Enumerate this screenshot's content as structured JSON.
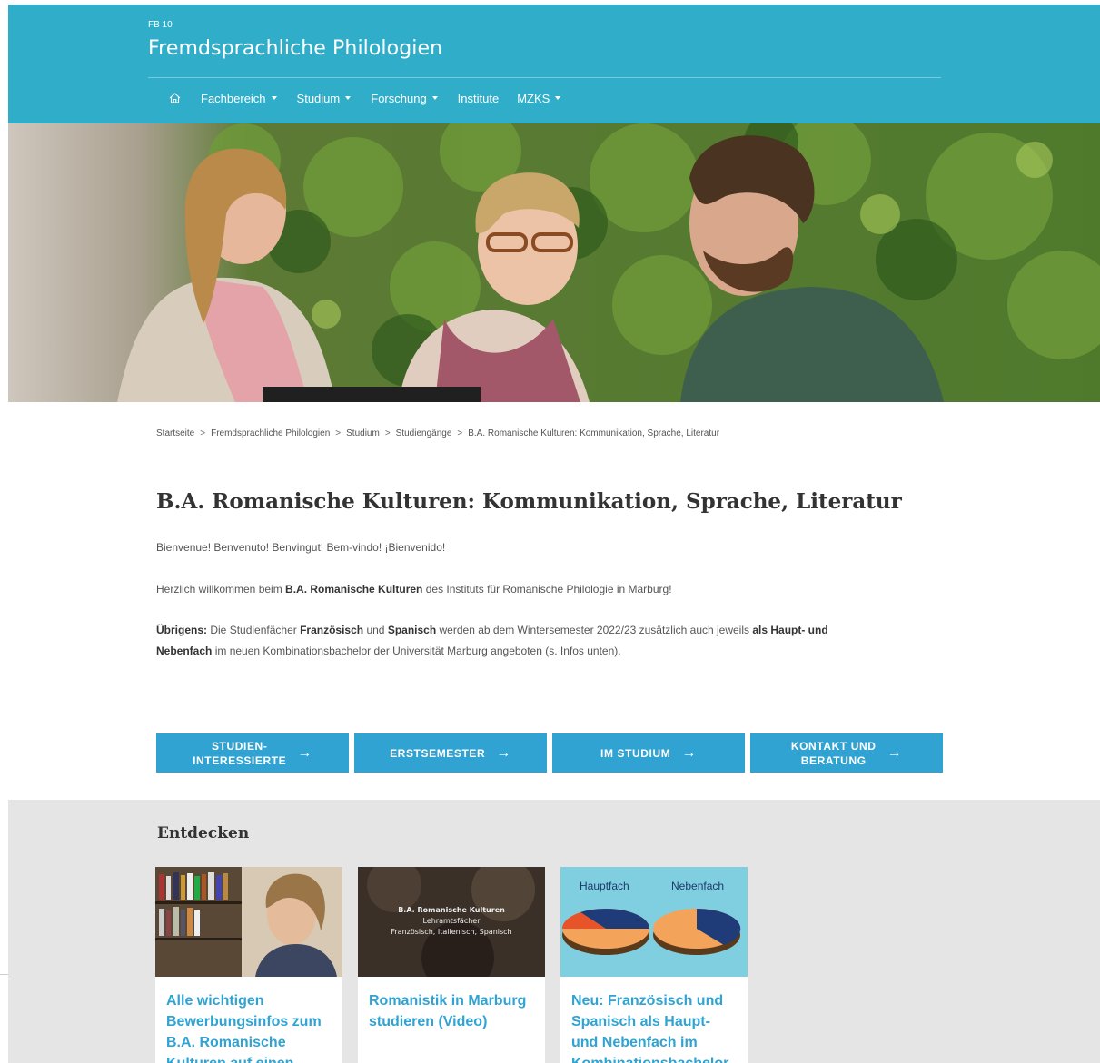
{
  "header": {
    "fb_label": "FB 10",
    "site_title": "Fremdsprachliche Philologien",
    "nav": [
      {
        "label": "Fachbereich",
        "has_dropdown": true
      },
      {
        "label": "Studium",
        "has_dropdown": true
      },
      {
        "label": "Forschung",
        "has_dropdown": true
      },
      {
        "label": "Institute",
        "has_dropdown": false
      },
      {
        "label": "MZKS",
        "has_dropdown": true
      }
    ],
    "home_icon": "home-icon"
  },
  "breadcrumb": [
    "Startseite",
    "Fremdsprachliche Philologien",
    "Studium",
    "Studiengänge",
    "B.A. Romanische Kulturen: Kommunikation, Sprache, Literatur"
  ],
  "breadcrumb_separator": ">",
  "page_title": "B.A. Romanische Kulturen: Kommunikation, Sprache, Literatur",
  "intro": {
    "greeting": "Bienvenue! Benvenuto! Benvingut! Bem-vindo! ¡Bienvenido!",
    "welcome_pre": "Herzlich willkommen beim ",
    "welcome_bold": "B.A. Romanische Kulturen",
    "welcome_post": " des Instituts für Romanische Philologie in Marburg!",
    "note_bold1": "Übrigens:",
    "note_t1": " Die Studienfächer ",
    "note_bold2": "Französisch",
    "note_t2": " und ",
    "note_bold3": "Spanisch",
    "note_t3": " werden ab dem Wintersemester 2022/23 zusätzlich auch jeweils ",
    "note_bold4": "als Haupt- und",
    "note_bold5": "Nebenfach",
    "note_t4": " im neuen Kombinationsbachelor der Universität Marburg angeboten (s. Infos unten)."
  },
  "cta_buttons": [
    {
      "line1": "STUDIEN-",
      "line2": "INTERESSIERTE"
    },
    {
      "line1": "ERSTSEMESTER",
      "line2": ""
    },
    {
      "line1": "IM STUDIUM",
      "line2": ""
    },
    {
      "line1": "KONTAKT UND",
      "line2": "BERATUNG"
    }
  ],
  "cta_arrow": "→",
  "discover": {
    "title": "Entdecken",
    "cards": [
      {
        "title": "Alle wichtigen Bewerbungsinfos zum B.A. Romanische Kulturen auf einen"
      },
      {
        "title": "Romanistik in Marburg studieren (Video)",
        "img_title": "B.A. Romanische Kulturen",
        "img_sub1": "Lehramtsfächer",
        "img_sub2": "Französisch, Italienisch, Spanisch"
      },
      {
        "title": "Neu: Französisch und Spanisch als Haupt- und Nebenfach im Kombinationsbachelor",
        "img_label_left": "Hauptfach",
        "img_label_right": "Nebenfach"
      }
    ]
  },
  "colors": {
    "header_bg": "#30aec9",
    "cta_bg": "#30a3d3",
    "link": "#30a3d3",
    "discover_bg": "#e5e5e5"
  }
}
